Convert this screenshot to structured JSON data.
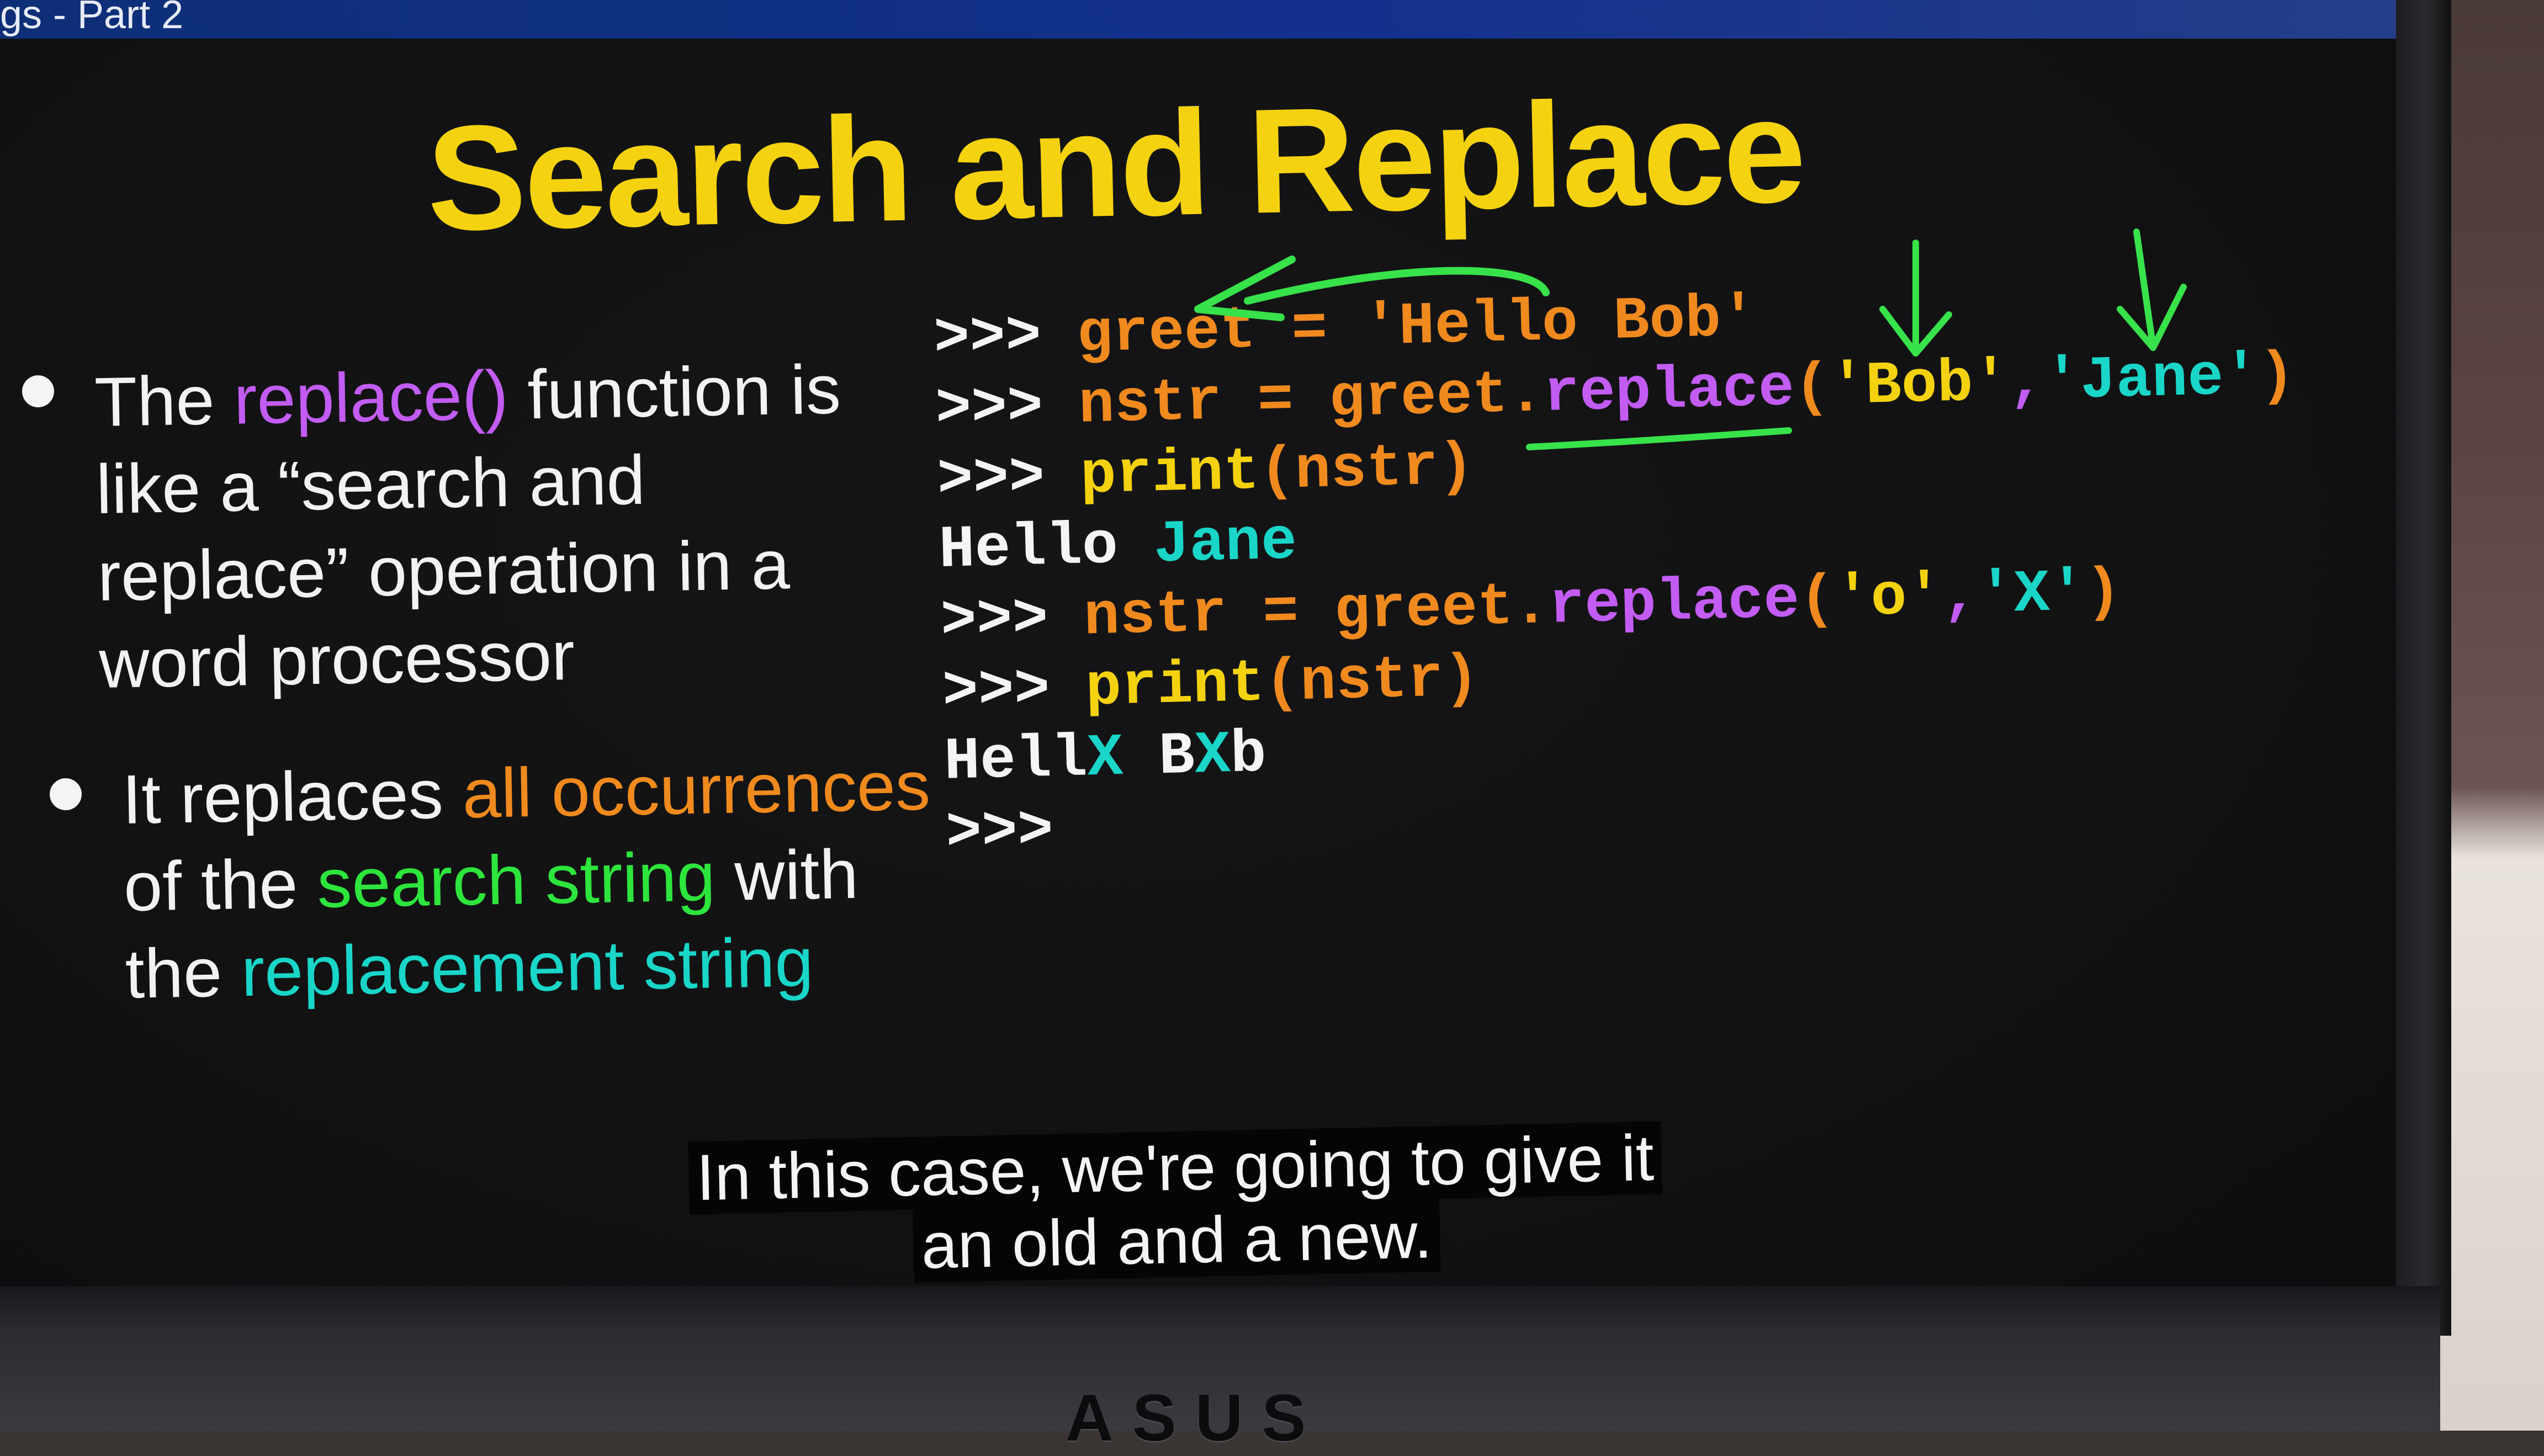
{
  "window": {
    "title": "gs - Part 2"
  },
  "slide": {
    "title": "Search and Replace",
    "bullet1": {
      "pre": "The ",
      "func": "replace()",
      "post": " function is like a “search and replace” operation in a word processor"
    },
    "bullet2": {
      "pre": "It replaces ",
      "all_occ": "all occurrences",
      "mid": " of the ",
      "search": "search string",
      "mid2": " with the ",
      "replacement": "replacement string"
    }
  },
  "code": {
    "l1": {
      "prompt": ">>> ",
      "a": "greet = ",
      "b": "'Hello Bob'"
    },
    "l2": {
      "prompt": ">>> ",
      "a": "nstr = greet.",
      "b": "replace",
      "c": "(",
      "d": "'Bob'",
      "e": ",",
      "f": "'Jane'",
      "g": ")"
    },
    "l3": {
      "prompt": ">>> ",
      "a": "print",
      "b": "(nstr)"
    },
    "l4": {
      "a": "Hello ",
      "b": "Jane"
    },
    "l5": {
      "prompt": ">>> ",
      "a": "nstr = greet.",
      "b": "replace",
      "c": "(",
      "d": "'o'",
      "e": ",",
      "f": "'X'",
      "g": ")"
    },
    "l6": {
      "prompt": ">>> ",
      "a": "print",
      "b": "(nstr)"
    },
    "l7": {
      "a": "Hell",
      "b": "X",
      "c": " B",
      "d": "X",
      "e": "b"
    },
    "l8": {
      "prompt": ">>>"
    }
  },
  "caption": {
    "line1": "In this case, we're going to give it",
    "line2": "an old and a new."
  },
  "brand": {
    "text": "ASUS"
  },
  "colors": {
    "title": "#f4d20f",
    "purple": "#c25cf2",
    "orange": "#f08a1e",
    "green": "#2de53c",
    "teal": "#19d6c8",
    "annotation": "#37e24a"
  }
}
